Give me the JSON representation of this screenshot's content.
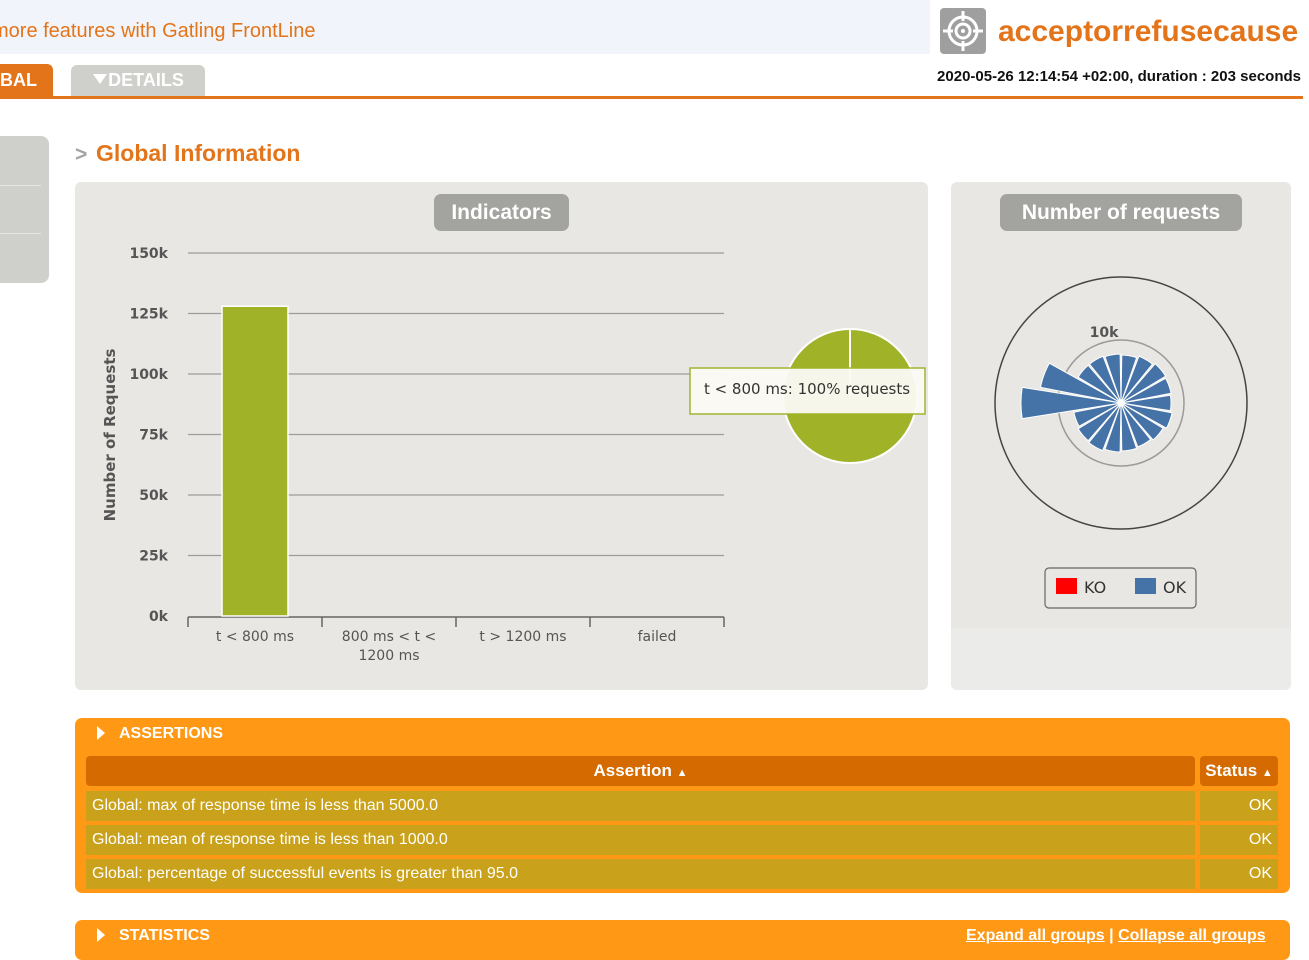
{
  "banner": {
    "text": "more features with Gatling FrontLine"
  },
  "brand": {
    "title": "acceptorrefusecause",
    "logo_icon": "target-icon"
  },
  "tabs": [
    {
      "label": "BAL",
      "active": true
    },
    {
      "label": "DETAILS",
      "icon": "triangle-down-icon",
      "active": false
    }
  ],
  "run_info": "2020-05-26 12:14:54 +02:00, duration : 203 seconds",
  "section": {
    "title": "Global Information",
    "marker": ">"
  },
  "indicators_panel": {
    "title": "Indicators"
  },
  "requests_panel": {
    "title": "Number of requests"
  },
  "chart_data": [
    {
      "type": "bar",
      "ylabel": "Number of Requests",
      "categories": [
        "t < 800 ms",
        "800 ms < t < 1200 ms",
        "t > 1200 ms",
        "failed"
      ],
      "category_lines": [
        [
          "t < 800 ms"
        ],
        [
          "800 ms < t <",
          "1200 ms"
        ],
        [
          "t > 1200 ms"
        ],
        [
          "failed"
        ]
      ],
      "values": [
        128000,
        0,
        0,
        0
      ],
      "ylim": [
        0,
        150000
      ],
      "yticks": [
        "0k",
        "25k",
        "50k",
        "75k",
        "100k",
        "125k",
        "150k"
      ],
      "yticks_values": [
        0,
        25000,
        50000,
        75000,
        100000,
        125000,
        150000
      ],
      "grid": true,
      "color": "#a0b228"
    },
    {
      "type": "pie",
      "slices": [
        {
          "label": "t < 800 ms",
          "percent": 100
        }
      ],
      "tooltip": "t < 800 ms: 100% requests",
      "color": "#a0b228"
    },
    {
      "type": "polar-area",
      "radial_label": "10k",
      "legend": [
        {
          "name": "KO",
          "color": "#ff0000"
        },
        {
          "name": "OK",
          "color": "#4572a7"
        }
      ]
    }
  ],
  "assertions": {
    "header": "ASSERTIONS",
    "columns": [
      "Assertion",
      "Status"
    ],
    "sort_icon": "sort-arrows-icon",
    "rows": [
      {
        "assertion": "Global: max of response time is less than 5000.0",
        "status": "OK"
      },
      {
        "assertion": "Global: mean of response time is less than 1000.0",
        "status": "OK"
      },
      {
        "assertion": "Global: percentage of successful events is greater than 95.0",
        "status": "OK"
      }
    ]
  },
  "statistics": {
    "header": "STATISTICS",
    "expand_label": "Expand all groups",
    "separator": "|",
    "collapse_label": "Collapse all groups"
  },
  "colors": {
    "accent": "#e3741a",
    "assert_bg": "#ff9814",
    "assert_header": "#d56b00",
    "row_bg": "#c9a11a"
  }
}
